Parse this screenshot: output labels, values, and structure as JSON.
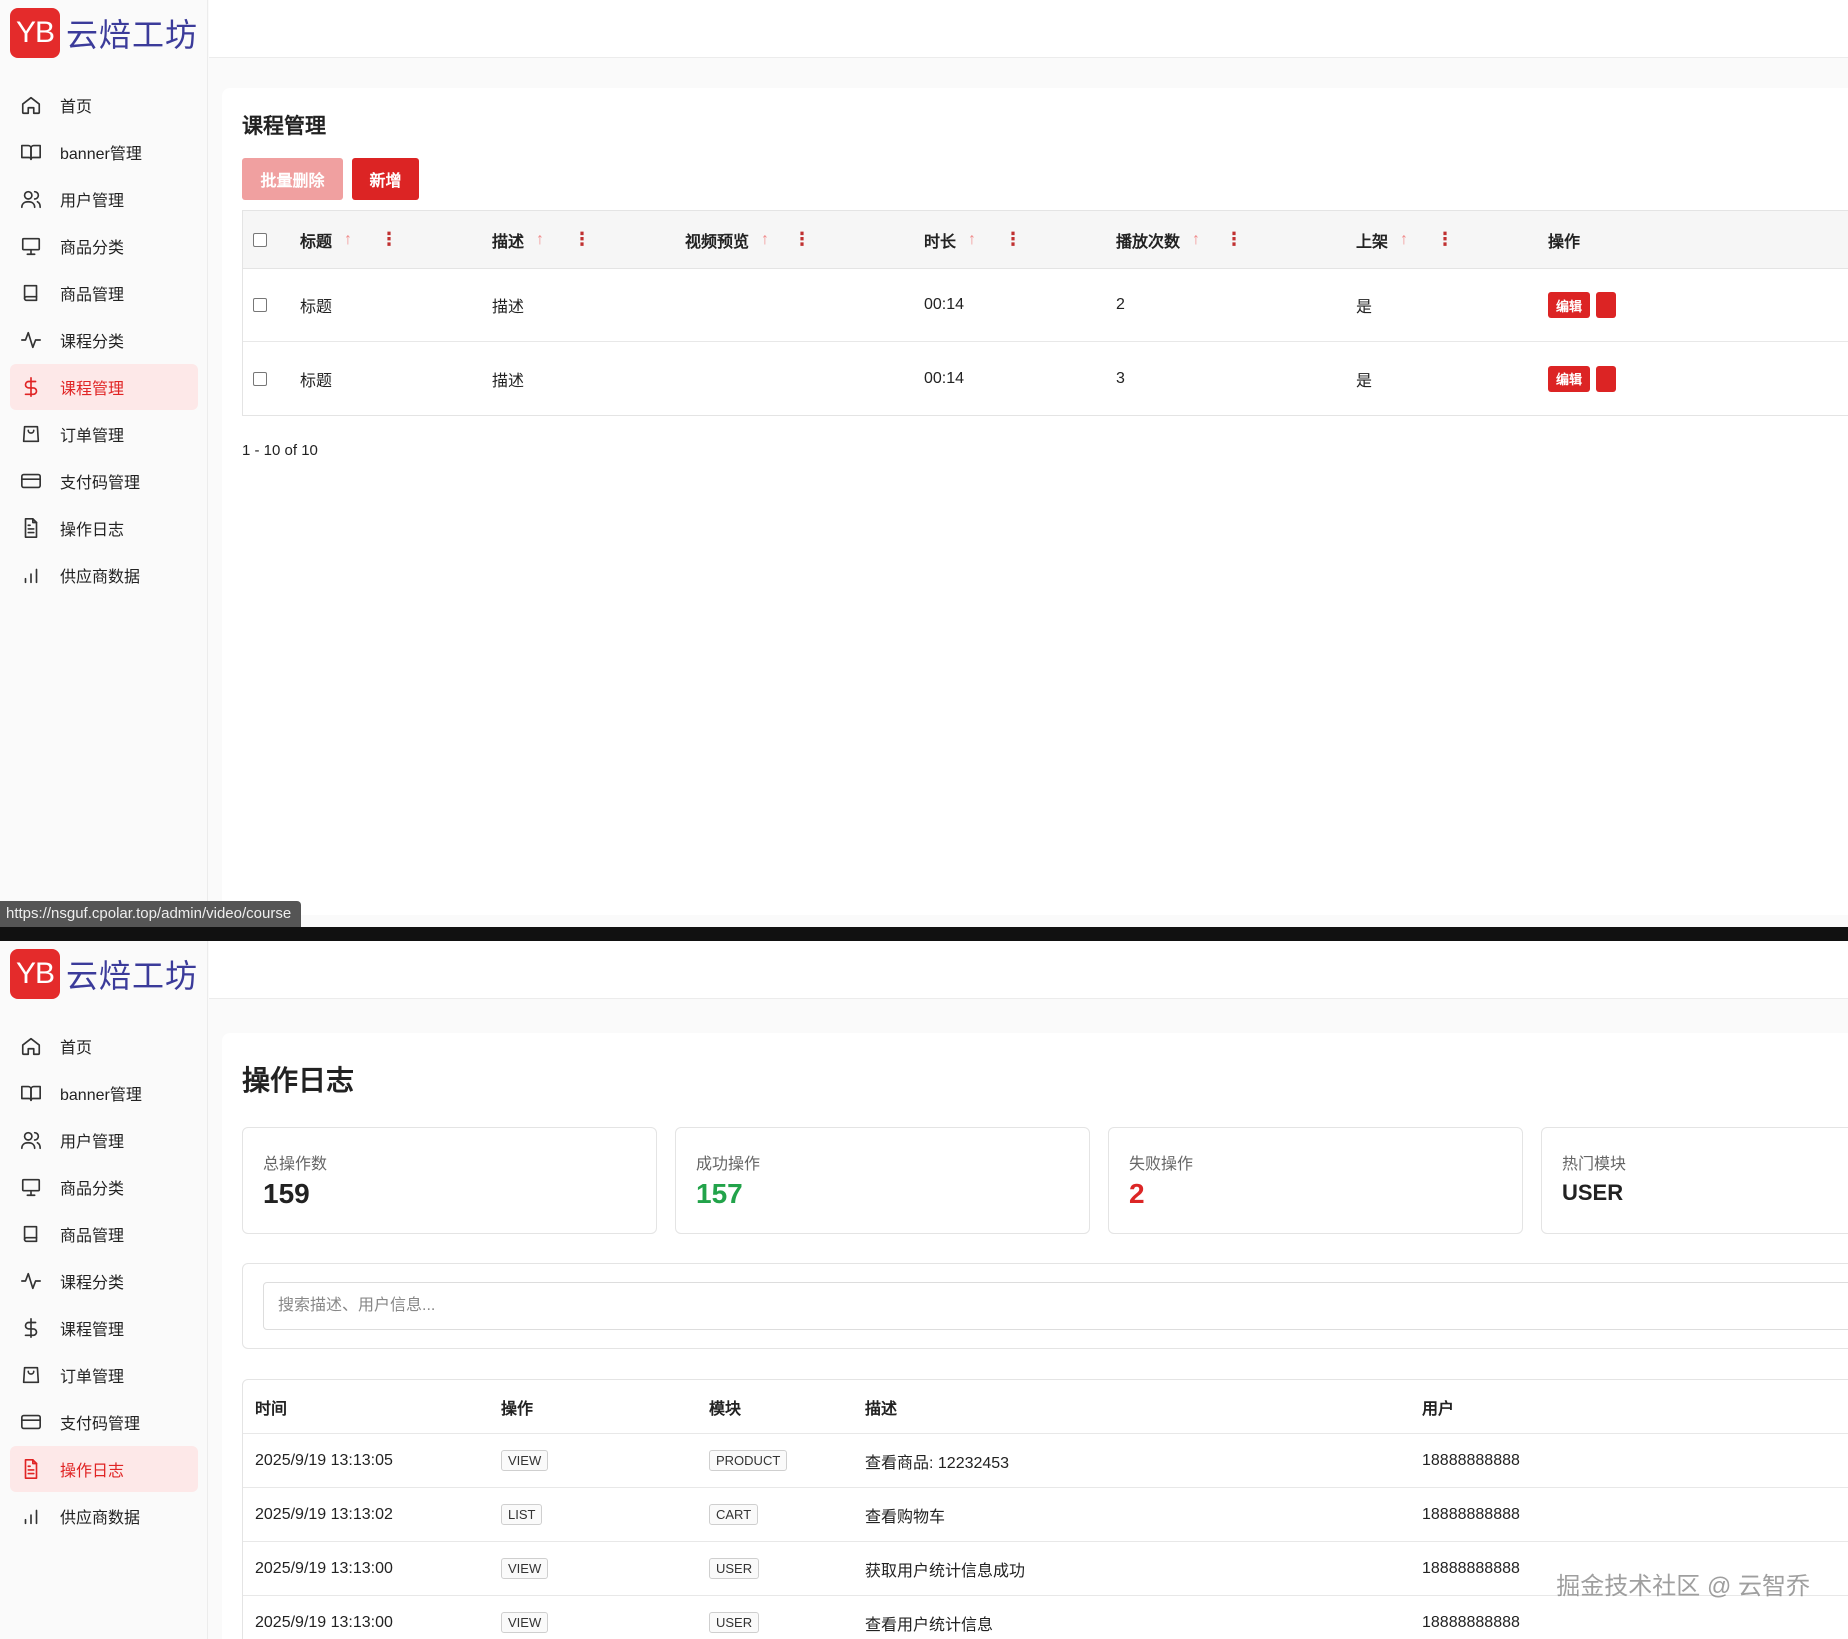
{
  "brand": {
    "badge": "YB",
    "name": "云焙工坊"
  },
  "status_bar_url": "https://nsguf.cpolar.top/admin/video/course",
  "nav_items": [
    "首页",
    "banner管理",
    "用户管理",
    "商品分类",
    "商品管理",
    "课程分类",
    "课程管理",
    "订单管理",
    "支付码管理",
    "操作日志",
    "供应商数据"
  ],
  "nav_icons": [
    "home-icon",
    "book-open-icon",
    "users-icon",
    "monitor-icon",
    "book-icon",
    "activity-icon",
    "dollar-icon",
    "shopping-bag-icon",
    "credit-card-icon",
    "file-text-icon",
    "bar-chart-icon"
  ],
  "screen1": {
    "active_nav": "课程管理",
    "title": "课程管理",
    "buttons": {
      "batch_delete": "批量删除",
      "add": "新增"
    },
    "columns": [
      "标题",
      "描述",
      "视频预览",
      "时长",
      "播放次数",
      "上架",
      "操作"
    ],
    "rows": [
      {
        "title": "标题",
        "desc": "描述",
        "preview": "",
        "duration": "00:14",
        "plays": "2",
        "listed": "是",
        "action": "编辑"
      },
      {
        "title": "标题",
        "desc": "描述",
        "preview": "",
        "duration": "00:14",
        "plays": "3",
        "listed": "是",
        "action": "编辑"
      }
    ],
    "pagination": "1 - 10 of 10"
  },
  "screen2": {
    "active_nav": "操作日志",
    "title": "操作日志",
    "stats": [
      {
        "label": "总操作数",
        "value": "159",
        "color": "#222222"
      },
      {
        "label": "成功操作",
        "value": "157",
        "color": "#22a34a"
      },
      {
        "label": "失败操作",
        "value": "2",
        "color": "#dc2626"
      },
      {
        "label": "热门模块",
        "value": "USER",
        "color": "#222222"
      }
    ],
    "search_placeholder": "搜索描述、用户信息...",
    "columns": [
      "时间",
      "操作",
      "模块",
      "描述",
      "用户"
    ],
    "rows": [
      {
        "time": "2025/9/19 13:13:05",
        "action": "VIEW",
        "module": "PRODUCT",
        "desc": "查看商品: 12232453",
        "user": "18888888888"
      },
      {
        "time": "2025/9/19 13:13:02",
        "action": "LIST",
        "module": "CART",
        "desc": "查看购物车",
        "user": "18888888888"
      },
      {
        "time": "2025/9/19 13:13:00",
        "action": "VIEW",
        "module": "USER",
        "desc": "获取用户统计信息成功",
        "user": "18888888888"
      },
      {
        "time": "2025/9/19 13:13:00",
        "action": "VIEW",
        "module": "USER",
        "desc": "查看用户统计信息",
        "user": "18888888888"
      }
    ]
  },
  "watermark": "掘金技术社区 @ 云智乔",
  "colors": {
    "accent": "#dc2424",
    "accent_light": "#fde8e8",
    "success": "#22a34a",
    "danger": "#dc2626"
  }
}
